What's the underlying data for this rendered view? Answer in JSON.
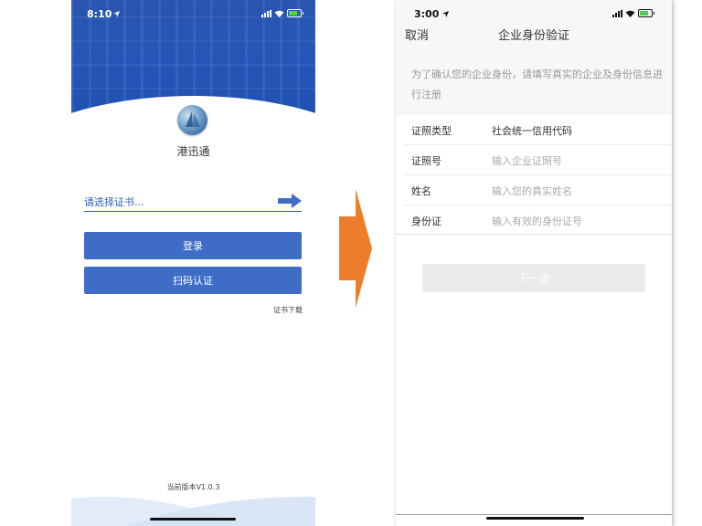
{
  "login": {
    "status": {
      "time": "8:10"
    },
    "app_name": "港迅通",
    "cert_select_placeholder": "请选择证书...",
    "login_button": "登录",
    "scan_button": "扫码认证",
    "cert_download_link": "证书下载",
    "version": "当前版本V1.0.3"
  },
  "verify": {
    "status": {
      "time": "3:00"
    },
    "nav": {
      "cancel": "取消",
      "title": "企业身份验证"
    },
    "notice": "为了确认您的企业身份，请填写真实的企业及身份信息进行注册",
    "fields": [
      {
        "label": "证照类型",
        "value": "社会统一信用代码"
      },
      {
        "label": "证照号",
        "placeholder": "输入企业证照号"
      },
      {
        "label": "姓名",
        "placeholder": "输入您的真实姓名"
      },
      {
        "label": "身份证",
        "placeholder": "输入有效的身份证号"
      }
    ],
    "next_button": "下一步"
  },
  "colors": {
    "brand_blue": "#3f6dc6",
    "header_blue": "#2456b8",
    "flow_arrow": "#ee7d2b",
    "disabled_button": "#ebebeb",
    "placeholder_gray": "#aaaaaa"
  },
  "icons": [
    "location-arrow-icon",
    "signal-icon",
    "wifi-icon",
    "battery-icon",
    "app-logo",
    "arrow-right-icon",
    "flow-arrow-icon"
  ]
}
